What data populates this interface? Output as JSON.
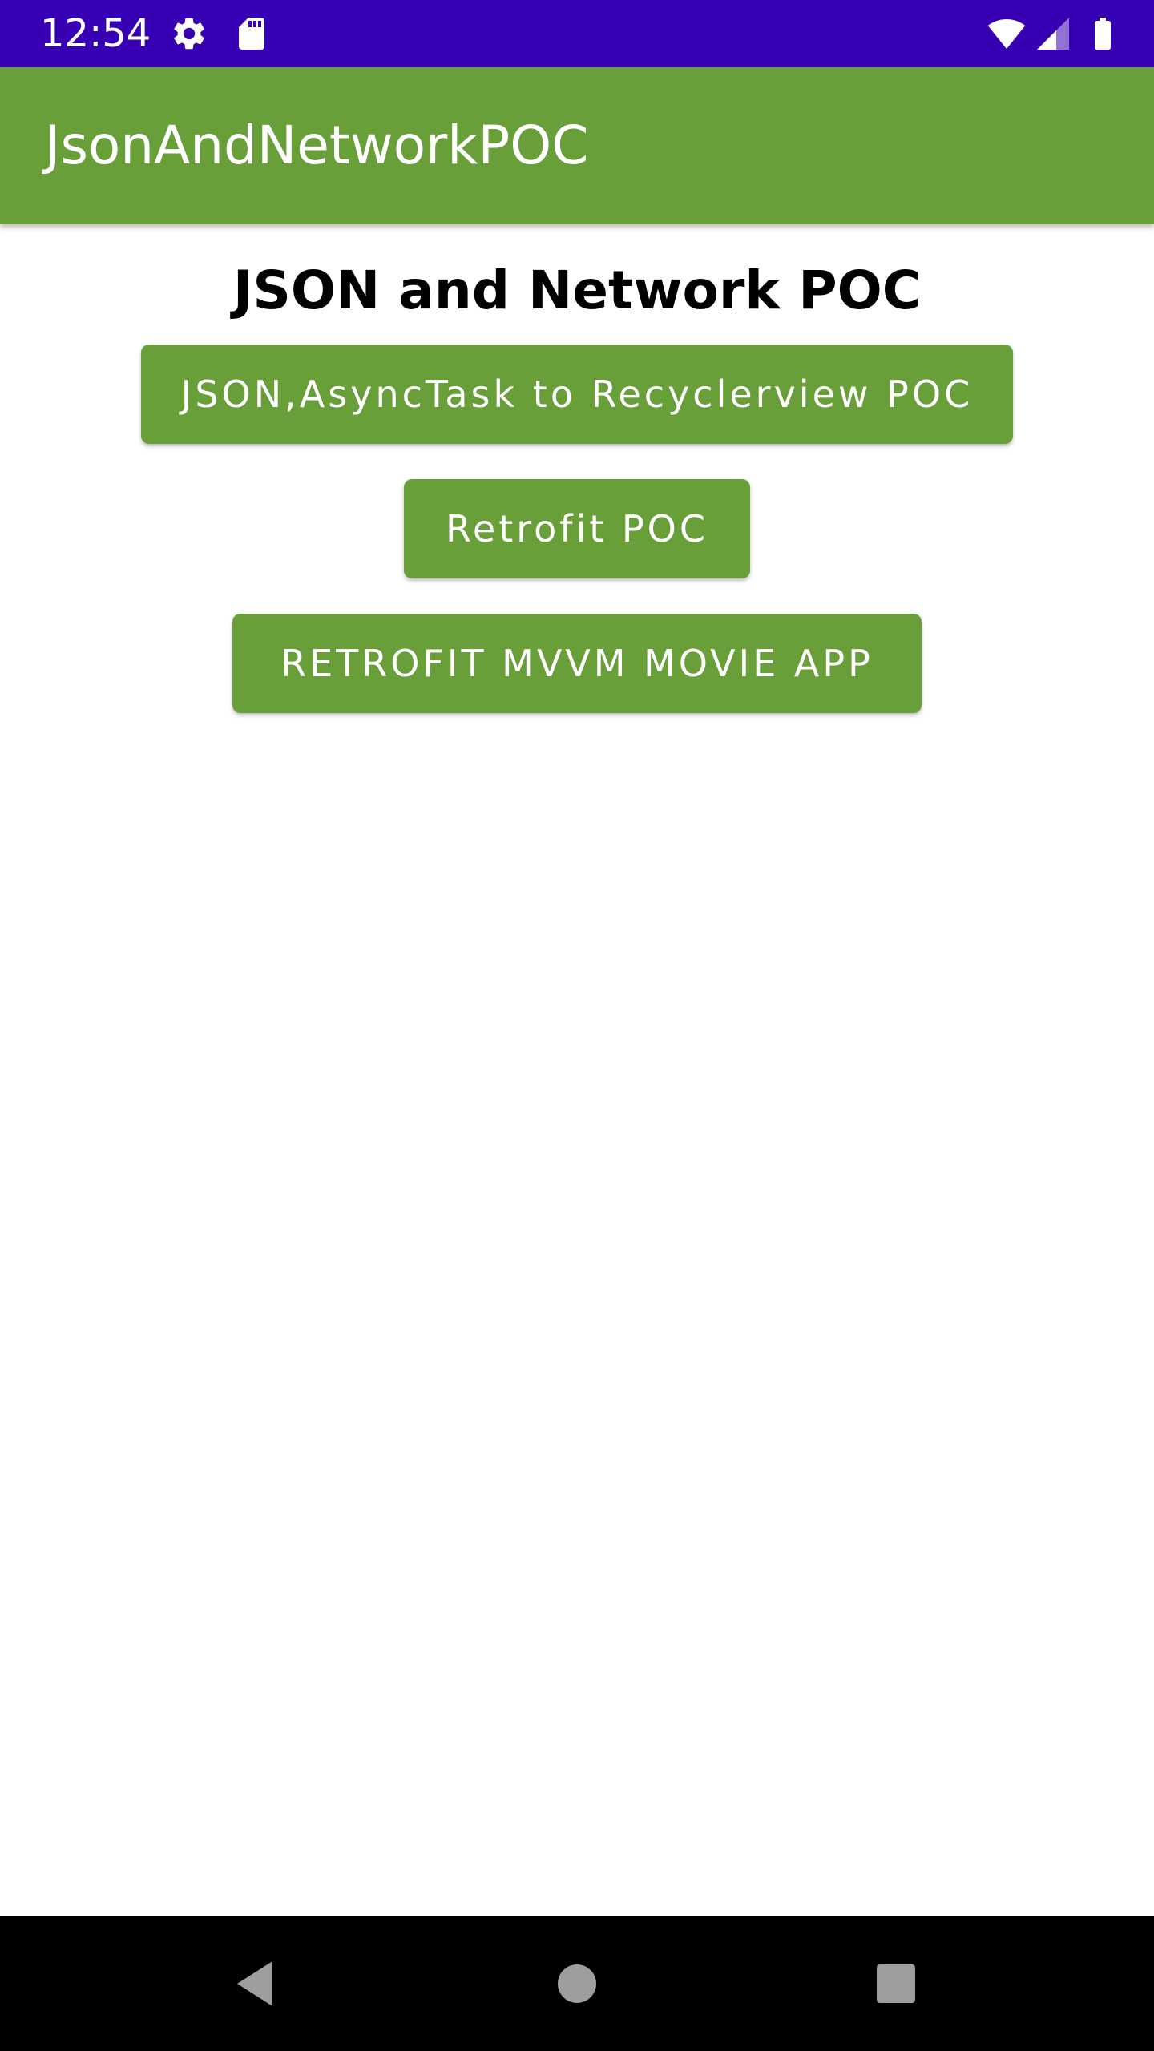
{
  "status_bar": {
    "time": "12:54",
    "background": "#3700b3",
    "icons": [
      "gear-icon",
      "sd-card-icon",
      "wifi-icon",
      "signal-icon",
      "battery-icon"
    ]
  },
  "app_bar": {
    "title": "JsonAndNetworkPOC",
    "background": "#689f38"
  },
  "main": {
    "heading": "JSON and Network POC",
    "buttons": [
      {
        "label": "JSON,AsyncTask to Recyclerview POC"
      },
      {
        "label": "Retrofit POC"
      },
      {
        "label": "RETROFIT MVVM MOVIE APP"
      }
    ],
    "button_color": "#689f38"
  },
  "nav_bar": {
    "icons": [
      "back-icon",
      "home-icon",
      "recents-icon"
    ]
  }
}
